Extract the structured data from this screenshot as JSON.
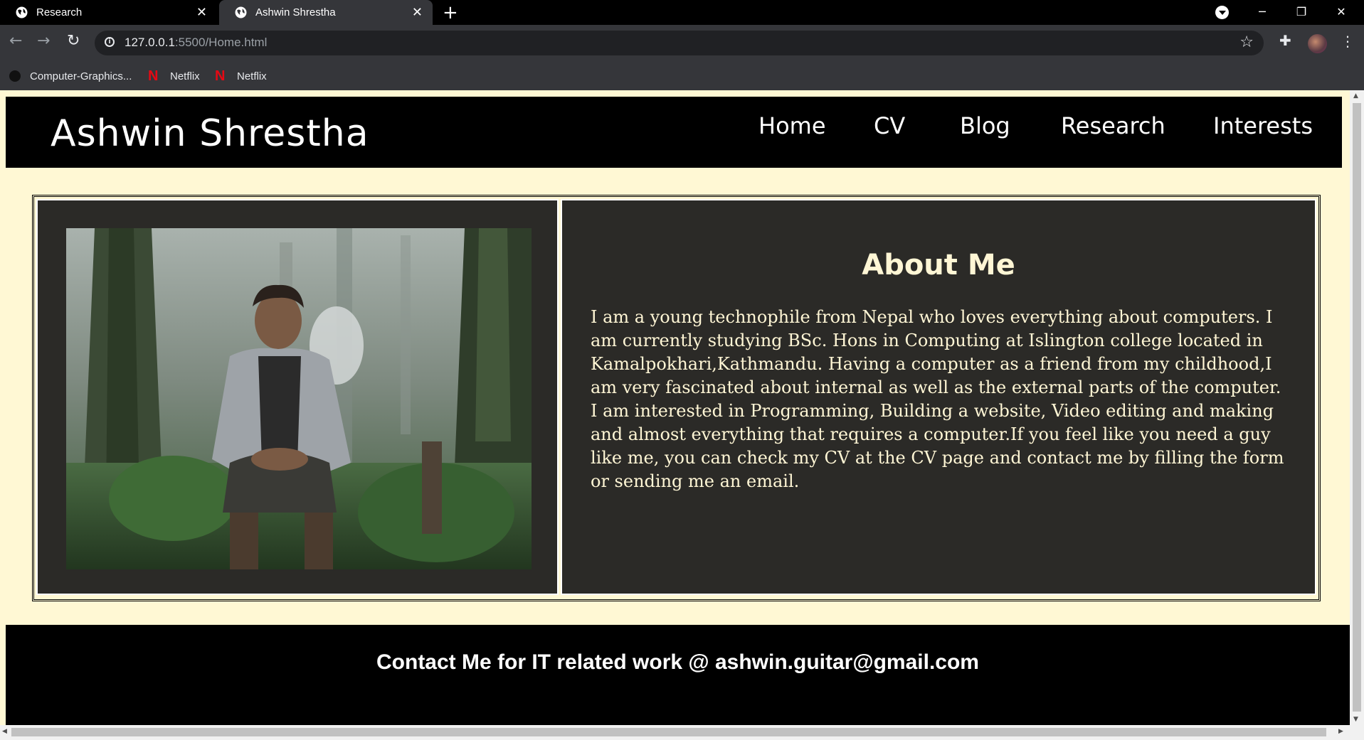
{
  "browser": {
    "tabs": [
      {
        "title": "Research",
        "active": false
      },
      {
        "title": "Ashwin Shrestha",
        "active": true
      }
    ],
    "new_tab_icon": "+",
    "url_host": "127.0.0.1",
    "url_path": ":5500/Home.html",
    "bookmarks": [
      {
        "label": "Computer-Graphics...",
        "icon": "github-icon"
      },
      {
        "label": "Netflix",
        "icon": "netflix-icon"
      },
      {
        "label": "Netflix",
        "icon": "netflix-icon"
      }
    ],
    "accent_color": "#35363a"
  },
  "site": {
    "title": "Ashwin Shrestha",
    "nav": [
      "Home",
      "CV",
      "Blog",
      "Research",
      "Interests"
    ],
    "about": {
      "heading": "About Me",
      "text": "I am a young technophile from Nepal who loves everything about computers. I am currently studying BSc. Hons in Computing at Islington college located in Kamalpokhari,Kathmandu. Having a computer as a friend from my childhood,I am very fascinated about internal as well as the external parts of the computer. I am interested in Programming, Building a website, Video editing and making and almost everything that requires a computer.If you feel like you need a guy like me, you can check my CV at the CV page and contact me by filling the form or sending me an email."
    },
    "footer": "Contact Me for IT related work @ ashwin.guitar@gmail.com",
    "colors": {
      "page_bg": "#fff8d4",
      "header_bg": "#000000",
      "panel_bg": "#2b2a27",
      "heading_text": "#fff6d5"
    }
  }
}
